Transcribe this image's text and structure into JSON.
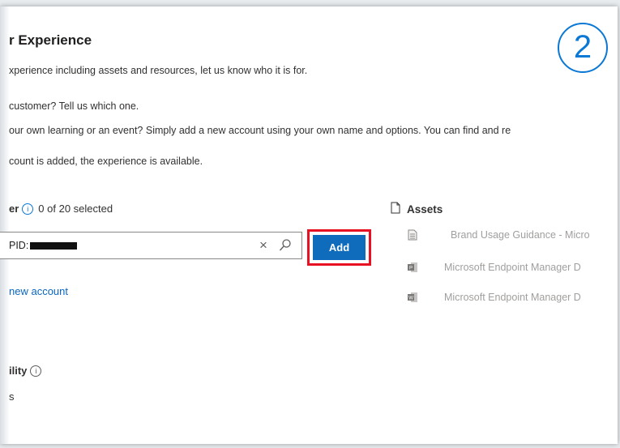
{
  "step_badge": "2",
  "page": {
    "title": "r Experience",
    "lines": [
      "xperience including assets and resources, let us know who it is for.",
      "customer? Tell us which one.",
      "our own learning or an event? Simply add a new account using your own name and options. You can find and re",
      "count is added, the experience is available."
    ]
  },
  "customer": {
    "label": "er",
    "selected_text": "0 of 20 selected",
    "search_value": "PID:",
    "add_label": "Add",
    "new_account_link": "new account"
  },
  "availability": {
    "label": "ility",
    "value": "s"
  },
  "assets": {
    "heading": "Assets",
    "items": [
      {
        "label": "Brand Usage Guidance - Micro",
        "icon": "document-icon"
      },
      {
        "label": "Microsoft Endpoint Manager D",
        "icon": "powerpoint-icon"
      },
      {
        "label": "Microsoft Endpoint Manager D",
        "icon": "word-icon"
      }
    ]
  },
  "colors": {
    "accent": "#0f6cbd",
    "highlight": "#e81123",
    "badge": "#0a78d4"
  }
}
